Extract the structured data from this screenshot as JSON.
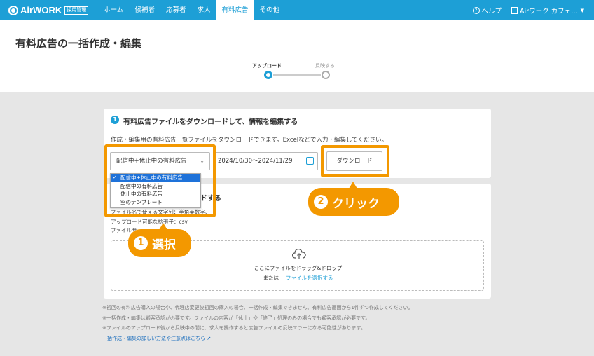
{
  "app": {
    "logo": "AirWORK",
    "logo_badge": "採用管理"
  },
  "nav": [
    {
      "label": "ホーム"
    },
    {
      "label": "候補者"
    },
    {
      "label": "応募者"
    },
    {
      "label": "求人"
    },
    {
      "label": "有料広告",
      "active": true
    },
    {
      "label": "その他"
    }
  ],
  "top_right": {
    "help_icon": "?",
    "help": "ヘルプ",
    "account": "Airワーク カフェ…"
  },
  "page": {
    "title": "有料広告の一括作成・編集"
  },
  "stepper": {
    "step1": "アップロード",
    "step2": "反映する"
  },
  "section1": {
    "number": "1",
    "title": "有料広告ファイルをダウンロードして、情報を編集する",
    "description": "作成・編集用の有料広告一覧ファイルをダウンロードできます。Excelなどで入力・編集してください。",
    "select_value": "配信中+休止中の有料広告",
    "date_range": "2024/10/30〜2024/11/29",
    "download_button": "ダウンロード",
    "options": [
      "配信中+休止中の有料広告",
      "配信中の有料広告",
      "休止中の有料広告",
      "空のテンプレート"
    ]
  },
  "section2": {
    "title_fragment": "ドする",
    "line1": "ファイル名で使える文字列：半角英数字、_",
    "line2": "アップロード可能な拡張子：csv",
    "line3": "ファイルサ",
    "dropzone_text": "ここにファイルをドラッグ&ドロップ",
    "dropzone_or": "または",
    "dropzone_link": "ファイルを選択する"
  },
  "notes": [
    "※初回の有料広告購入の場合や、代理店変更後初回の購入の場合、一括作成・編集できません。有料広告画面から1件ずつ作成してください。",
    "※一括作成・編集は顧客承認が必要です。ファイルの内容が「休止」や「終了」処理のみの場合でも顧客承認が必要です。",
    "※ファイルのアップロード後から反映中の間に、求人を操作すると広告ファイルの反映エラーになる可能性があります。"
  ],
  "help_link": "一括作成・編集の詳しい方法や注意点はこちら",
  "callouts": {
    "select": {
      "num": "1",
      "label": "選択"
    },
    "click": {
      "num": "2",
      "label": "クリック"
    }
  },
  "colors": {
    "brand": "#1d9fd6",
    "highlight": "#f39800",
    "selected_option": "#1e72d9"
  }
}
